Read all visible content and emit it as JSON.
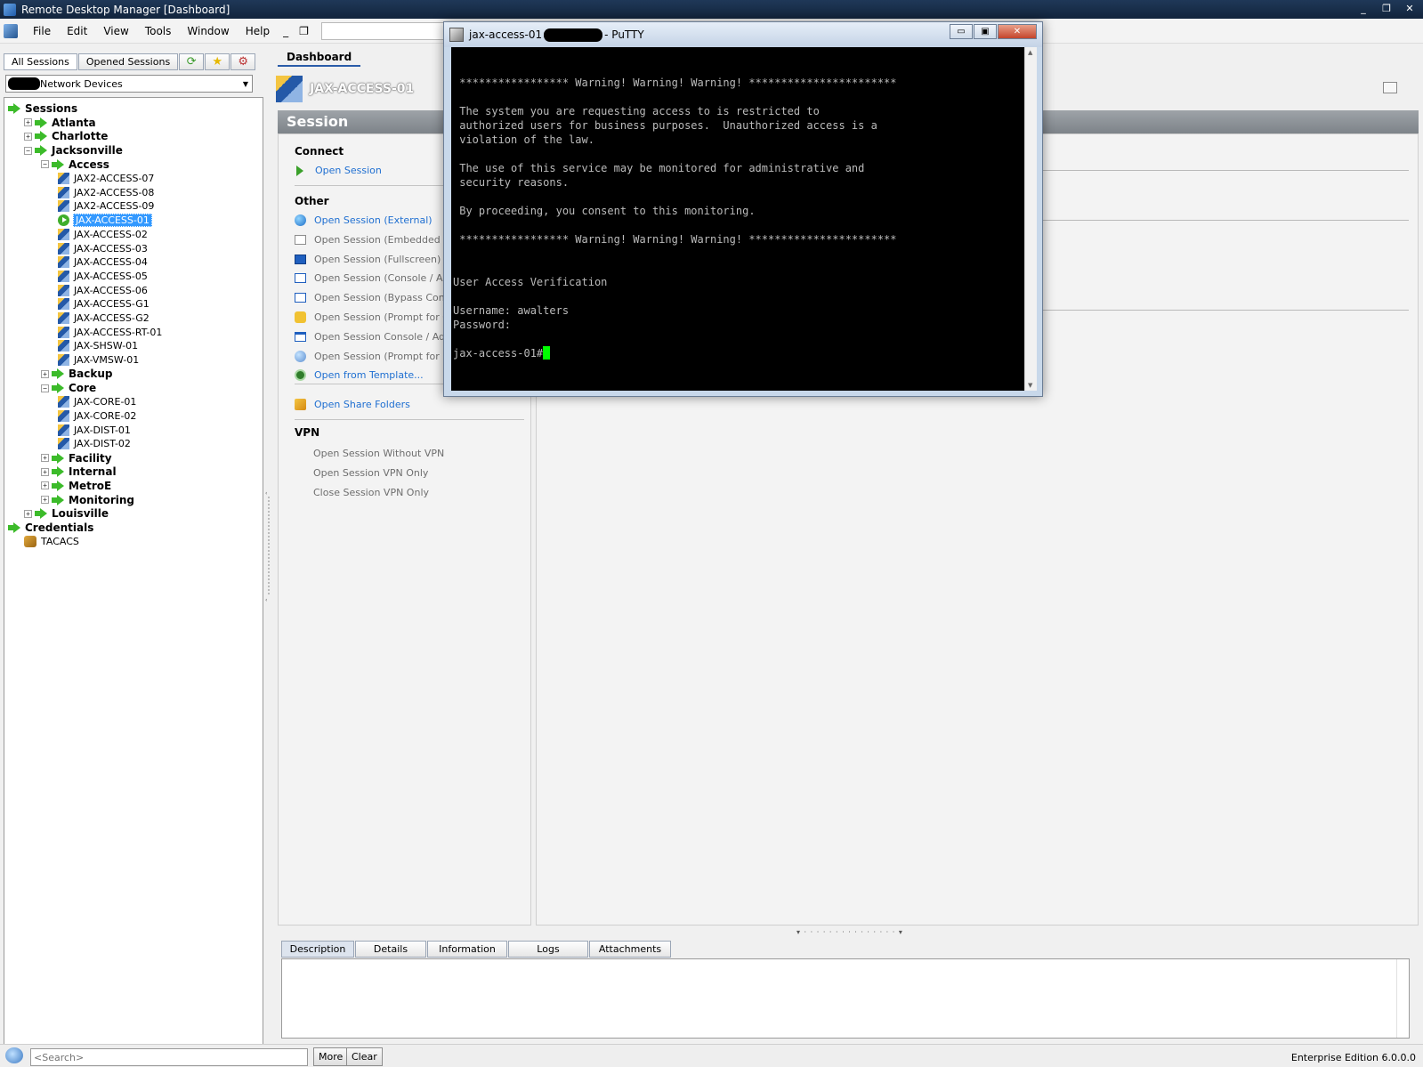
{
  "window": {
    "title": "Remote Desktop Manager [Dashboard]",
    "controls": [
      "_",
      "❐",
      "✕"
    ]
  },
  "menu": {
    "items": [
      "File",
      "Edit",
      "View",
      "Tools",
      "Window",
      "Help"
    ],
    "mdi": [
      "_",
      "❐"
    ]
  },
  "left": {
    "tabs": [
      "All Sessions",
      "Opened Sessions"
    ],
    "vault": "Network Devices"
  },
  "tree": [
    {
      "depth": 0,
      "label": "Sessions",
      "kind": "folder",
      "expander": ""
    },
    {
      "depth": 1,
      "label": "Atlanta",
      "kind": "folder",
      "expander": "+"
    },
    {
      "depth": 1,
      "label": "Charlotte",
      "kind": "folder",
      "expander": "+"
    },
    {
      "depth": 1,
      "label": "Jacksonville",
      "kind": "folder",
      "expander": "−"
    },
    {
      "depth": 2,
      "label": "Access",
      "kind": "folder",
      "expander": "−"
    },
    {
      "depth": 3,
      "label": "JAX2-ACCESS-07",
      "kind": "leaf"
    },
    {
      "depth": 3,
      "label": "JAX2-ACCESS-08",
      "kind": "leaf"
    },
    {
      "depth": 3,
      "label": "JAX2-ACCESS-09",
      "kind": "leaf"
    },
    {
      "depth": 3,
      "label": "JAX-ACCESS-01",
      "kind": "leaf",
      "selected": true
    },
    {
      "depth": 3,
      "label": "JAX-ACCESS-02",
      "kind": "leaf"
    },
    {
      "depth": 3,
      "label": "JAX-ACCESS-03",
      "kind": "leaf"
    },
    {
      "depth": 3,
      "label": "JAX-ACCESS-04",
      "kind": "leaf"
    },
    {
      "depth": 3,
      "label": "JAX-ACCESS-05",
      "kind": "leaf"
    },
    {
      "depth": 3,
      "label": "JAX-ACCESS-06",
      "kind": "leaf"
    },
    {
      "depth": 3,
      "label": "JAX-ACCESS-G1",
      "kind": "leaf"
    },
    {
      "depth": 3,
      "label": "JAX-ACCESS-G2",
      "kind": "leaf"
    },
    {
      "depth": 3,
      "label": "JAX-ACCESS-RT-01",
      "kind": "leaf"
    },
    {
      "depth": 3,
      "label": "JAX-SHSW-01",
      "kind": "leaf"
    },
    {
      "depth": 3,
      "label": "JAX-VMSW-01",
      "kind": "leaf"
    },
    {
      "depth": 2,
      "label": "Backup",
      "kind": "folder",
      "expander": "+"
    },
    {
      "depth": 2,
      "label": "Core",
      "kind": "folder",
      "expander": "−"
    },
    {
      "depth": 3,
      "label": "JAX-CORE-01",
      "kind": "leaf"
    },
    {
      "depth": 3,
      "label": "JAX-CORE-02",
      "kind": "leaf"
    },
    {
      "depth": 3,
      "label": "JAX-DIST-01",
      "kind": "leaf"
    },
    {
      "depth": 3,
      "label": "JAX-DIST-02",
      "kind": "leaf"
    },
    {
      "depth": 2,
      "label": "Facility",
      "kind": "folder",
      "expander": "+"
    },
    {
      "depth": 2,
      "label": "Internal",
      "kind": "folder",
      "expander": "+"
    },
    {
      "depth": 2,
      "label": "MetroE",
      "kind": "folder",
      "expander": "+"
    },
    {
      "depth": 2,
      "label": "Monitoring",
      "kind": "folder",
      "expander": "+"
    },
    {
      "depth": 1,
      "label": "Louisville",
      "kind": "folder",
      "expander": "+"
    },
    {
      "depth": 0,
      "label": "Credentials",
      "kind": "folder",
      "expander": ""
    },
    {
      "depth": 1,
      "label": "TACACS",
      "kind": "credential"
    }
  ],
  "main": {
    "dashboard_tab": "Dashboard",
    "entry_title": "JAX-ACCESS-01",
    "session_header": "Session",
    "connect_heading": "Connect",
    "open_session": "Open Session",
    "other_heading": "Other",
    "other_actions": [
      {
        "label": "Open Session (External)",
        "icon": "globe-icon",
        "style": "link"
      },
      {
        "label": "Open Session (Embedded / T",
        "icon": "folder-icon",
        "style": "dim"
      },
      {
        "label": "Open Session (Fullscreen)",
        "icon": "fullscreen-icon",
        "style": "dim"
      },
      {
        "label": "Open Session (Console / Adm",
        "icon": "console-icon",
        "style": "dim"
      },
      {
        "label": "Open Session (Bypass Conso",
        "icon": "window-icon",
        "style": "dim"
      },
      {
        "label": "Open Session (Prompt for Cre",
        "icon": "lock-icon",
        "style": "dim"
      },
      {
        "label": "Open Session Console / Adm",
        "icon": "console-window-icon",
        "style": "dim"
      },
      {
        "label": "Open Session (Prompt for Ho",
        "icon": "globe-prompt-icon",
        "style": "dim"
      },
      {
        "label": "Open from Template...",
        "icon": "template-icon",
        "style": "link"
      }
    ],
    "share_folders": "Open Share Folders",
    "vpn_heading": "VPN",
    "vpn_actions": [
      "Open Session Without VPN",
      "Open Session VPN Only",
      "Close Session VPN Only"
    ],
    "bottom_tabs": [
      "Description",
      "Details",
      "Information",
      "Logs",
      "Attachments"
    ]
  },
  "status": {
    "search_placeholder": "<Search>",
    "more": "More",
    "clear": "Clear",
    "edition": "Enterprise Edition 6.0.0.0"
  },
  "putty": {
    "title_prefix": "jax-access-01",
    "title_suffix": "- PuTTY",
    "controls": [
      "▭",
      "▣",
      "✕"
    ],
    "lines": [
      "",
      " ***************** Warning! Warning! Warning! ***********************",
      "",
      " The system you are requesting access to is restricted to",
      " authorized users for business purposes.  Unauthorized access is a",
      " violation of the law.",
      "",
      " The use of this service may be monitored for administrative and",
      " security reasons.",
      "",
      " By proceeding, you consent to this monitoring.",
      "",
      " ***************** Warning! Warning! Warning! ***********************",
      "",
      "",
      "User Access Verification",
      "",
      "Username: awalters",
      "Password:",
      ""
    ],
    "prompt": "jax-access-01#"
  }
}
